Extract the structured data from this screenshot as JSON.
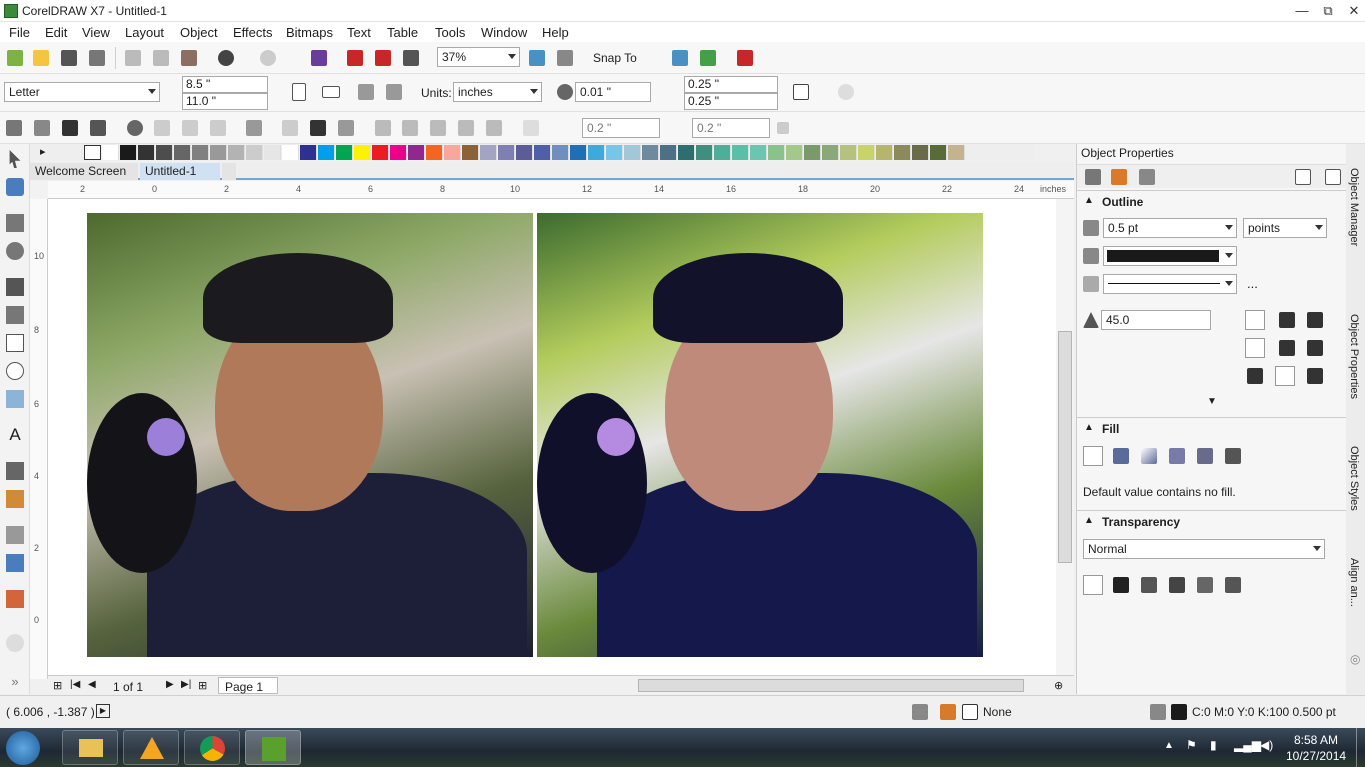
{
  "window": {
    "title": "CorelDRAW X7 - Untitled-1",
    "minimize": "—",
    "restore": "⧉",
    "close": "✕"
  },
  "menu": [
    "File",
    "Edit",
    "View",
    "Layout",
    "Object",
    "Effects",
    "Bitmaps",
    "Text",
    "Table",
    "Tools",
    "Window",
    "Help"
  ],
  "standard_toolbar": {
    "zoom": "37%",
    "snap_to": "Snap To"
  },
  "property_bar": {
    "page_size": "Letter",
    "width": "8.5 \"",
    "height": "11.0 \"",
    "units_label": "Units:",
    "units": "inches",
    "nudge": "0.01 \"",
    "dup_x": "0.25 \"",
    "dup_y": "0.25 \""
  },
  "secondary_toolbar": {
    "field1": "0.2 \"",
    "field2": "0.2 \""
  },
  "document_tabs": [
    {
      "label": "Welcome Screen"
    },
    {
      "label": "Untitled-1"
    }
  ],
  "ruler": {
    "unit": "inches",
    "h_ticks": [
      "2",
      "0",
      "2",
      "4",
      "6",
      "8",
      "10",
      "12",
      "14",
      "16",
      "18",
      "20",
      "22",
      "24"
    ],
    "v_ticks": [
      "10",
      "8",
      "6",
      "4",
      "2",
      "0"
    ]
  },
  "page_nav": {
    "count": "1 of 1",
    "page_tab": "Page 1"
  },
  "palette": [
    "#ffffff",
    "#1a1a1a",
    "#333333",
    "#4d4d4d",
    "#666666",
    "#808080",
    "#999999",
    "#b3b3b3",
    "#cccccc",
    "#e6e6e6",
    "#ffffff",
    "#2e3192",
    "#00a0e9",
    "#00a651",
    "#fff200",
    "#ed1c24",
    "#ec008c",
    "#92278f",
    "#f26522",
    "#f7a79b",
    "#8c6239",
    "#a3a3c2",
    "#7f7fb3",
    "#5c5c99",
    "#4f5fa8",
    "#6f8fbf",
    "#1e6fb5",
    "#3fa9dc",
    "#77c6e8",
    "#a2c7d6",
    "#6d8a9e",
    "#4d7087",
    "#2d6e6e",
    "#3f8f7f",
    "#4fae9a",
    "#5abfa8",
    "#6cc5b0",
    "#8ac28c",
    "#a3c98a",
    "#7a9a6a",
    "#8aa878",
    "#b5c27d",
    "#c8d46a",
    "#b5b56e",
    "#8a8a5a",
    "#6b6b4a",
    "#5a6b3a",
    "#c4b38f"
  ],
  "docker": {
    "title": "Object Properties",
    "outline": {
      "title": "Outline",
      "width": "0.5 pt",
      "units": "points",
      "more": "...",
      "miter": "45.0"
    },
    "fill": {
      "title": "Fill",
      "message": "Default value contains no fill."
    },
    "transparency": {
      "title": "Transparency",
      "mode": "Normal"
    },
    "tabs": [
      "Object Manager",
      "Object Properties",
      "Object Styles",
      "Align an..."
    ]
  },
  "status": {
    "coords": "( 6.006 , -1.387 )",
    "fill": "None",
    "outline": "C:0 M:0 Y:0 K:100  0.500 pt"
  },
  "taskbar": {
    "time": "8:58 AM",
    "date": "10/27/2014"
  },
  "colors": {
    "accent": "#73a6d2",
    "taskbar": "#1e2833"
  }
}
